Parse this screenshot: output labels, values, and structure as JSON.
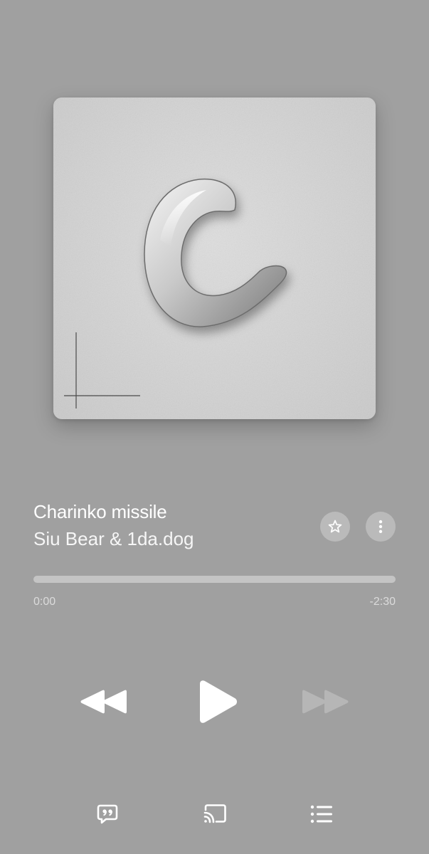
{
  "track": {
    "title": "Charinko missile",
    "artist": "Siu Bear & 1da.dog"
  },
  "playback": {
    "elapsed": "0:00",
    "remaining": "-2:30",
    "progress_fraction": 0.0,
    "state": "paused"
  },
  "icons": {
    "artwork": "album-artwork",
    "favorite": "star-icon",
    "more": "vertical-ellipsis-icon",
    "rewind": "rewind-icon",
    "play": "play-icon",
    "forward": "fast-forward-icon",
    "lyrics": "lyrics-quote-bubble-icon",
    "cast": "airplay-cast-icon",
    "queue": "queue-list-icon"
  },
  "colors": {
    "background": "#a0a0a0",
    "foreground": "#ffffff",
    "disabled": "#b8b8b8"
  }
}
